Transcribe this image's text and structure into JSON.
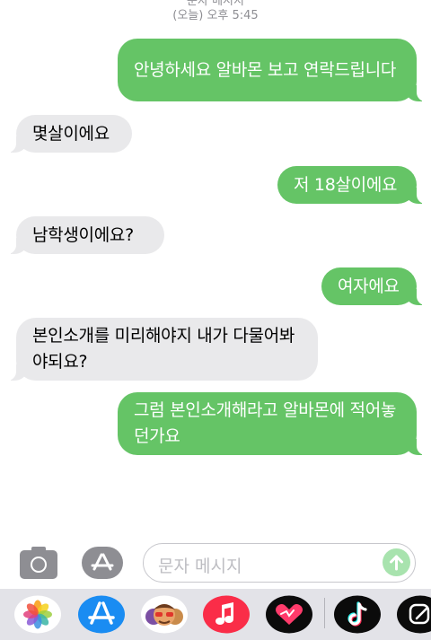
{
  "header": {
    "sender_line": "문자 메시지",
    "time_line": "(오늘) 오후 5:45"
  },
  "messages": [
    {
      "direction": "sent",
      "text": "안녕하세요 알바몬 보고 연락드립니다"
    },
    {
      "direction": "received",
      "text": "몇살이에요"
    },
    {
      "direction": "sent",
      "text": "저 18살이에요"
    },
    {
      "direction": "received",
      "text": "남학생이에요?"
    },
    {
      "direction": "sent",
      "text": "여자에요"
    },
    {
      "direction": "received",
      "text": "본인소개를 미리해야지 내가 다물어봐야되요?"
    },
    {
      "direction": "sent",
      "text": "그럼 본인소개해라고 알바몬에 적어놓던가요"
    }
  ],
  "composer": {
    "placeholder": "문자 메시지",
    "camera_icon": "camera-icon",
    "apps_icon": "app-store-icon",
    "send_icon": "arrow-up-icon"
  },
  "app_tray": [
    {
      "icon": "photos-icon"
    },
    {
      "icon": "app-store-icon"
    },
    {
      "icon": "memoji-icon"
    },
    {
      "icon": "music-icon"
    },
    {
      "icon": "digital-touch-icon"
    },
    {
      "icon": "tiktok-icon"
    },
    {
      "icon": "edit-icon"
    }
  ],
  "colors": {
    "sent_bubble": "#65c466",
    "received_bubble": "#e9e9eb",
    "tray_background": "#e3e3e8",
    "music_red": "#fa2d48",
    "app_store_blue": "#1a8cf2"
  }
}
